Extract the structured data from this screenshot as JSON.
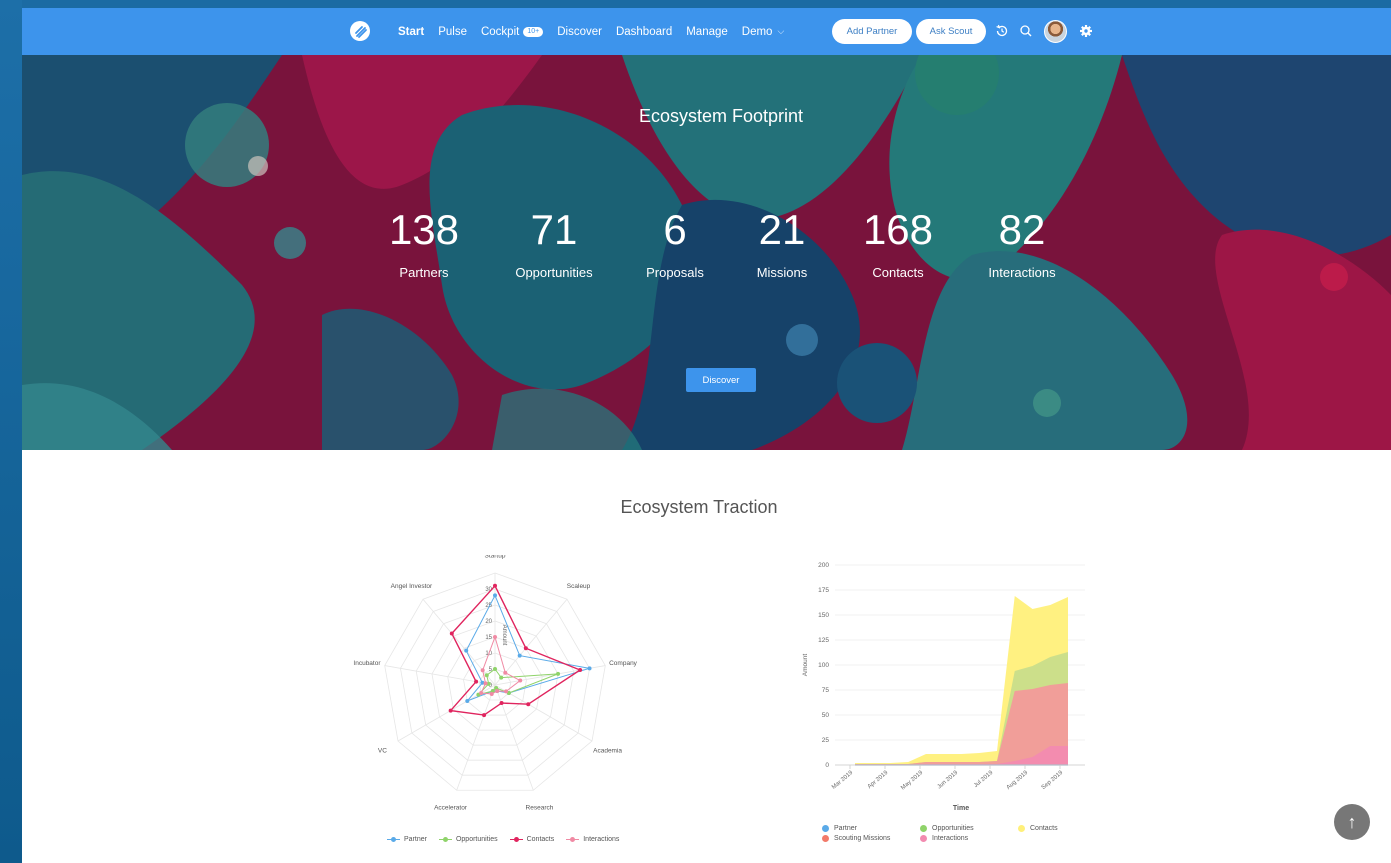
{
  "nav": {
    "links": [
      {
        "label": "Start",
        "active": true
      },
      {
        "label": "Pulse"
      },
      {
        "label": "Cockpit",
        "badge": "10+"
      },
      {
        "label": "Discover"
      },
      {
        "label": "Dashboard"
      },
      {
        "label": "Manage"
      },
      {
        "label": "Demo",
        "caret": "⌵"
      }
    ],
    "add_partner": "Add Partner",
    "ask_scout": "Ask Scout",
    "icons": [
      "logo-icon",
      "history-icon",
      "search-icon",
      "avatar",
      "gear-icon"
    ]
  },
  "hero": {
    "title": "Ecosystem Footprint",
    "stats": [
      {
        "value": "138",
        "label": "Partners"
      },
      {
        "value": "71",
        "label": "Opportunities"
      },
      {
        "value": "6",
        "label": "Proposals"
      },
      {
        "value": "21",
        "label": "Missions"
      },
      {
        "value": "168",
        "label": "Contacts"
      },
      {
        "value": "82",
        "label": "Interactions"
      }
    ],
    "button": "Discover"
  },
  "traction": {
    "title": "Ecosystem Traction"
  },
  "colors": {
    "nav": "#3d94ec",
    "partner": "#5aaae8",
    "opportunities": "#8fd36a",
    "contacts": "#e0245e",
    "interactions": "#f08aa4",
    "contacts_area": "#fff07a",
    "opportunities_area": "#c9dd8a",
    "missions_area": "#f29a9a",
    "interactions_area": "#f28bb0"
  },
  "chart_data": [
    {
      "type": "radar",
      "categories": [
        "Startup",
        "Scaleup",
        "Company",
        "Academia",
        "Research",
        "Accelerator",
        "VC",
        "Incubator",
        "Angel Investor"
      ],
      "axis_label": "Amount",
      "ticks": [
        "0",
        "5",
        "10",
        "15",
        "20",
        "25",
        "30"
      ],
      "rmax": 35,
      "series": [
        {
          "name": "Partner",
          "values": [
            28,
            12,
            30,
            5,
            2,
            2,
            10,
            4,
            14
          ]
        },
        {
          "name": "Opportunities",
          "values": [
            5,
            3,
            20,
            5,
            1,
            2,
            6,
            2,
            4
          ]
        },
        {
          "name": "Contacts",
          "values": [
            31,
            15,
            27,
            12,
            6,
            10,
            16,
            6,
            21
          ]
        },
        {
          "name": "Interactions",
          "values": [
            15,
            5,
            8,
            4,
            2,
            3,
            5,
            3,
            6
          ]
        }
      ]
    },
    {
      "type": "area",
      "x": [
        "Mar 2019",
        "Apr 2019",
        "May 2019",
        "Jun 2019",
        "Jul 2019",
        "Aug 2019",
        "Sep 2019"
      ],
      "xlabel": "Time",
      "ylabel": "Amount",
      "ylim": [
        0,
        200
      ],
      "yticks": [
        "0",
        "25",
        "50",
        "75",
        "100",
        "125",
        "150",
        "175",
        "200"
      ],
      "stacked": true,
      "series": [
        {
          "name": "Partner",
          "values": [
            0,
            0,
            0,
            0,
            0,
            0,
            0,
            0,
            0,
            0,
            0,
            0,
            0
          ]
        },
        {
          "name": "Opportunities",
          "values": [
            0,
            0,
            0,
            0,
            0,
            0,
            0,
            0,
            0,
            20,
            23,
            28,
            31
          ]
        },
        {
          "name": "Contacts",
          "values": [
            1,
            1,
            1,
            2,
            8,
            8,
            8,
            9,
            10,
            75,
            57,
            52,
            55
          ]
        },
        {
          "name": "Scouting Missions",
          "values": [
            1,
            1,
            1,
            1,
            2,
            2,
            2,
            2,
            3,
            70,
            68,
            61,
            63
          ]
        },
        {
          "name": "Interactions",
          "values": [
            0,
            0,
            0,
            0,
            1,
            1,
            1,
            1,
            1,
            4,
            8,
            19,
            19
          ]
        }
      ],
      "legend": [
        "Partner",
        "Opportunities",
        "Contacts",
        "Scouting Missions",
        "Interactions"
      ]
    }
  ],
  "scroll_top": "↑"
}
